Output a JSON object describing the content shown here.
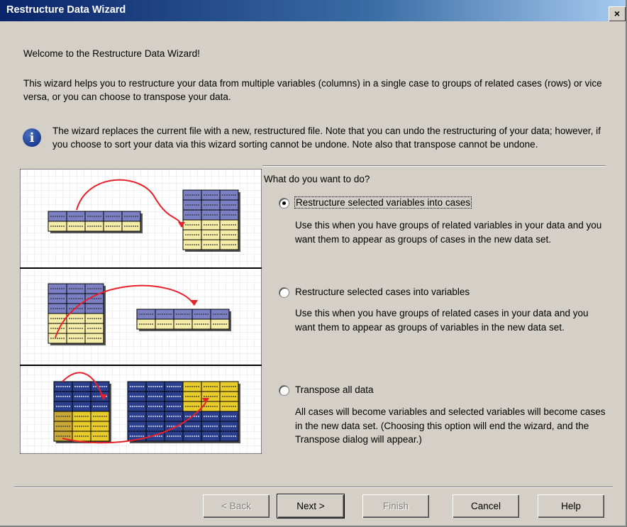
{
  "window": {
    "title": "Restructure Data Wizard",
    "close_glyph": "×"
  },
  "intro": {
    "welcome": "Welcome to the Restructure Data Wizard!",
    "description": "This wizard helps you to restructure your data from multiple variables (columns) in a single case to groups of related cases (rows) or vice versa, or you can choose to transpose your data.",
    "info_icon": "info-icon",
    "info_glyph": "i",
    "note": "The wizard replaces the current file with a new, restructured file.  Note that you can undo the restructuring of your data; however, if you choose to sort your data via this wizard sorting cannot be undone.  Note also that transpose cannot be undone."
  },
  "question": "What do you want to do?",
  "options": [
    {
      "label": "Restructure selected variables into cases",
      "selected": true,
      "description": "Use this when you have groups of related variables in your data and you want them to appear as groups of cases in the new data set."
    },
    {
      "label": "Restructure selected cases into variables",
      "selected": false,
      "description": "Use this when you have groups of related cases in your data and you want them to appear as groups of variables in the new data set."
    },
    {
      "label": "Transpose all data",
      "selected": false,
      "description": "All cases will become variables and selected variables will become cases in the new data set. (Choosing this option will end the wizard, and the Transpose dialog will appear.)"
    }
  ],
  "buttons": {
    "back": "< Back",
    "next": "Next >",
    "finish": "Finish",
    "cancel": "Cancel",
    "help": "Help"
  },
  "colors": {
    "title_start": "#0a246a",
    "title_end": "#a6caf0",
    "dialog_bg": "#d4d0c8",
    "cell_header": "#7b7fc4",
    "cell_body": "#f5eca8",
    "cell_dark": "#2b3f8c",
    "cell_yellow": "#e8cc2c",
    "arrow": "#e8202a",
    "grid": "#e3e3e3"
  }
}
